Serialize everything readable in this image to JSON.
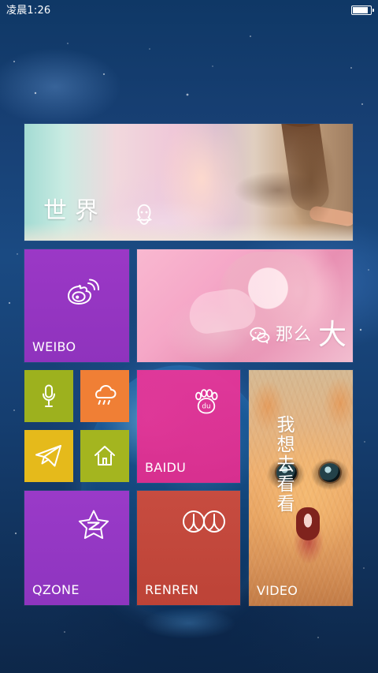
{
  "status_bar": {
    "time": "凌晨1:26",
    "battery_level": 0.92,
    "battery_icon": "battery-icon"
  },
  "tiles": {
    "banner": {
      "caption": "世界",
      "icon": "qq-icon"
    },
    "weibo": {
      "label": "WEIBO",
      "icon": "weibo-icon"
    },
    "pink": {
      "caption_prefix": "那么",
      "caption_large": "大",
      "icon": "wechat-icon"
    },
    "mic": {
      "icon": "microphone-icon"
    },
    "weather": {
      "icon": "cloud-rain-icon"
    },
    "send": {
      "icon": "paper-plane-icon"
    },
    "home": {
      "icon": "home-icon"
    },
    "baidu": {
      "label": "BAIDU",
      "icon": "baidu-icon",
      "icon_text": "du"
    },
    "video": {
      "label": "VIDEO",
      "vertical_text": "我想去看看"
    },
    "qzone": {
      "label": "QZONE",
      "icon": "qzone-icon"
    },
    "renren": {
      "label": "RENREN",
      "icon": "renren-icon"
    }
  },
  "colors": {
    "weibo": "#9b38c6",
    "mic": "#9db11e",
    "weather": "#f07f35",
    "send": "#e5ba1b",
    "home": "#a4b51f",
    "baidu": "#e93699",
    "qzone": "#9a3ac8",
    "renren": "#c74c40"
  }
}
